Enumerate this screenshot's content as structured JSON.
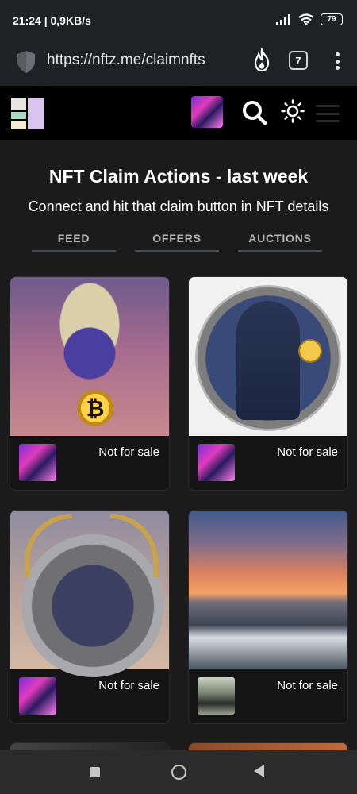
{
  "status_bar": {
    "time_speed": "21:24 | 0,9KB/s",
    "battery": "79"
  },
  "browser": {
    "url": "https://nftz.me/claimnfts",
    "tab_count": "7"
  },
  "page": {
    "title": "NFT Claim Actions - last week",
    "subtitle": "Connect and hit that claim button in NFT details",
    "tabs": [
      {
        "label": "FEED"
      },
      {
        "label": "OFFERS"
      },
      {
        "label": "AUCTIONS"
      }
    ]
  },
  "cards": [
    {
      "status": "Not for sale",
      "coin_symbol": "₿"
    },
    {
      "status": "Not for sale"
    },
    {
      "status": "Not for sale"
    },
    {
      "status": "Not for sale"
    }
  ],
  "colors": {
    "background": "#1b1b1c",
    "header": "#000000",
    "card": "#141414",
    "tab_underline": "#454a5c"
  }
}
